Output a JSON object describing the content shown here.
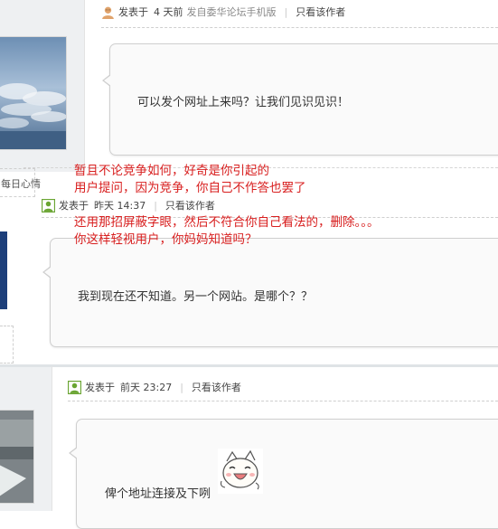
{
  "posts": [
    {
      "meta_prefix": "发表于",
      "time": "4 天前",
      "source": "发自委华论坛手机版",
      "author_only": "只看该作者",
      "content": "可以发个网址上来吗？让我们见识见识！"
    },
    {
      "meta_prefix": "发表于",
      "time": "昨天 14:37",
      "author_only": "只看该作者",
      "content": "我到现在还不知道。另一个网站。是哪个？？"
    },
    {
      "meta_prefix": "发表于",
      "time": "前天 23:27",
      "author_only": "只看该作者",
      "content": "俾个地址连接及下咧"
    }
  ],
  "sidebar": {
    "cutoff_text": "每日心情"
  },
  "annotation": {
    "lines": [
      "暂且不论竞争如何，好奇是你引起的",
      "用户提问，因为竞争，你自己不作答也罢了",
      "还用那招屏蔽字眼，然后不符合你自己看法的，删除。。。",
      "你这样轻视用户，你妈妈知道吗？"
    ],
    "color": "#d81e1e"
  },
  "icons": {
    "user_icon_1": "user-avatar-icon",
    "user_icon_2": "online-user-icon",
    "emoticon": "laughing-face-emoticon"
  }
}
